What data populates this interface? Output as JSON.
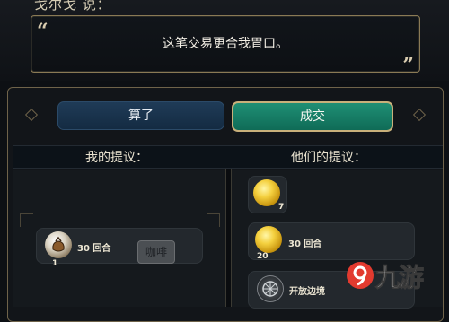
{
  "dialog": {
    "speaker": "戈尔戈 说：",
    "open_quote": "“",
    "close_quote": "”",
    "message": "这笔交易更合我胃口。"
  },
  "buttons": {
    "cancel_label": "算了",
    "accept_label": "成交"
  },
  "columns": {
    "mine_title": "我的提议：",
    "theirs_title": "他们的提议："
  },
  "my_offer": {
    "item_turns": "30 回合",
    "item_count": "1",
    "resource_label": "咖啡"
  },
  "their_offer": {
    "gold_count": "7",
    "gold_per_turn_count": "20",
    "gold_per_turn_turns": "30 回合",
    "open_borders_label": "开放边境"
  },
  "watermark": {
    "text": "九游"
  },
  "colors": {
    "accept": "#138066",
    "cancel": "#1b3550",
    "border_gold": "#8a7a55",
    "gold_coin": "#f4d03f"
  }
}
